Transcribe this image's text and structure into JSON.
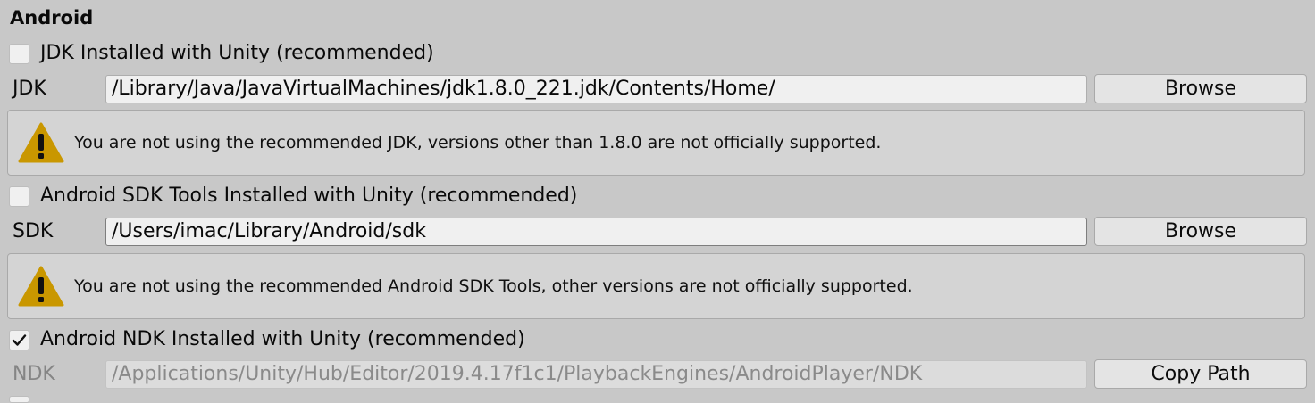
{
  "section": {
    "title": "Android"
  },
  "jdk": {
    "toggle_label": "JDK Installed with Unity (recommended)",
    "toggle_checked": false,
    "field_label": "JDK",
    "path": "/Library/Java/JavaVirtualMachines/jdk1.8.0_221.jdk/Contents/Home/",
    "button_label": "Browse",
    "warning": "You are not using the recommended JDK, versions other than 1.8.0 are not officially supported."
  },
  "sdk": {
    "toggle_label": "Android SDK Tools Installed with Unity (recommended)",
    "toggle_checked": false,
    "field_label": "SDK",
    "path": "/Users/imac/Library/Android/sdk",
    "button_label": "Browse",
    "warning": "You are not using the recommended Android SDK Tools, other versions are not officially supported."
  },
  "ndk": {
    "toggle_label": "Android NDK Installed with Unity (recommended)",
    "toggle_checked": true,
    "field_label": "NDK",
    "path": "/Applications/Unity/Hub/Editor/2019.4.17f1c1/PlaybackEngines/AndroidPlayer/NDK",
    "button_label": "Copy Path"
  },
  "icons": {
    "warning": "warning-icon",
    "checkmark": "checkmark-icon"
  },
  "colors": {
    "background": "#c8c8c8",
    "field_background": "#f0f0f0",
    "warning_fill": "#c99700"
  }
}
